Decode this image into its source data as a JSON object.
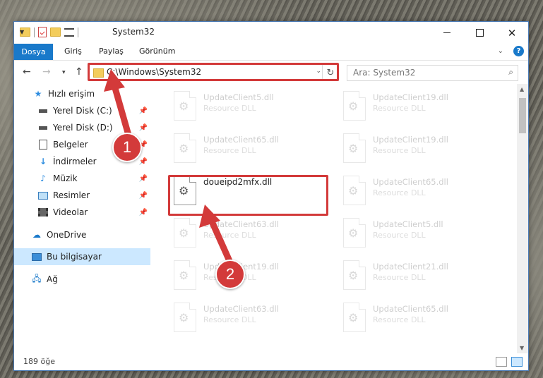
{
  "window": {
    "title": "System32",
    "controls": {
      "minimize": "minimize-icon",
      "maximize": "maximize-icon",
      "close": "close-icon"
    }
  },
  "ribbon": {
    "tabs": [
      {
        "label": "Dosya",
        "active": true
      },
      {
        "label": "Giriş"
      },
      {
        "label": "Paylaş"
      },
      {
        "label": "Görünüm"
      }
    ],
    "help": "?"
  },
  "navbar": {
    "address": "C:\\Windows\\System32",
    "search_placeholder": "Ara: System32"
  },
  "sidebar": {
    "items": [
      {
        "label": "Hızlı erişim",
        "icon": "star-icon"
      },
      {
        "label": "Yerel Disk (C:)",
        "icon": "drive-icon",
        "pinned": true
      },
      {
        "label": "Yerel Disk (D:)",
        "icon": "drive-icon",
        "pinned": true
      },
      {
        "label": "Belgeler",
        "icon": "documents-icon",
        "pinned": true
      },
      {
        "label": "İndirmeler",
        "icon": "download-icon",
        "pinned": true
      },
      {
        "label": "Müzik",
        "icon": "music-icon",
        "pinned": true
      },
      {
        "label": "Resimler",
        "icon": "pictures-icon",
        "pinned": true
      },
      {
        "label": "Videolar",
        "icon": "video-icon",
        "pinned": true
      },
      {
        "label": "OneDrive",
        "icon": "cloud-icon"
      },
      {
        "label": "Bu bilgisayar",
        "icon": "computer-icon",
        "selected": true
      },
      {
        "label": "Ağ",
        "icon": "network-icon"
      }
    ]
  },
  "files": [
    {
      "name": "UpdateClient5.dll",
      "type": "Resource DLL"
    },
    {
      "name": "UpdateClient19.dll",
      "type": "Resource DLL"
    },
    {
      "name": "UpdateClient65.dll",
      "type": "Resource DLL"
    },
    {
      "name": "UpdateClient19.dll",
      "type": "Resource DLL"
    },
    {
      "name": "doueipd2mfx.dll",
      "type": ""
    },
    {
      "name": "UpdateClient65.dll",
      "type": "Resource DLL"
    },
    {
      "name": "UpdateClient63.dll",
      "type": "Resource DLL"
    },
    {
      "name": "UpdateClient5.dll",
      "type": "Resource DLL"
    },
    {
      "name": "UpdateClient19.dll",
      "type": "Resource DLL"
    },
    {
      "name": "UpdateClient21.dll",
      "type": "Resource DLL"
    },
    {
      "name": "UpdateClient63.dll",
      "type": "Resource DLL"
    },
    {
      "name": "UpdateClient65.dll",
      "type": "Resource DLL"
    }
  ],
  "status": {
    "count": "189 öğe"
  },
  "annotations": {
    "step1": "1",
    "step2": "2",
    "color": "#d33a3a"
  }
}
